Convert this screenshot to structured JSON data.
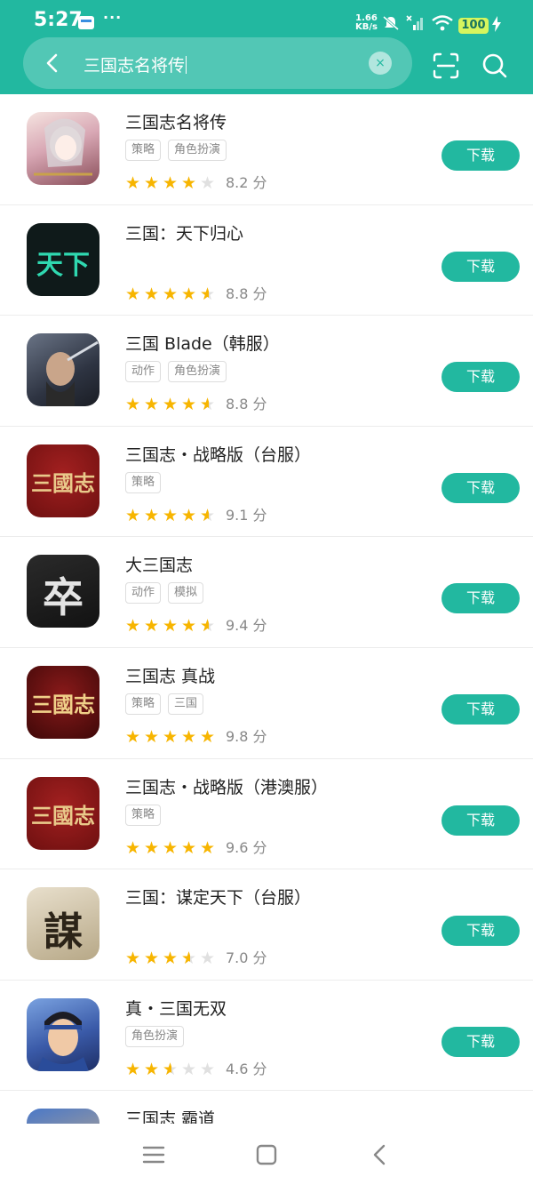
{
  "status_bar": {
    "time": "5:27",
    "more": "···",
    "net_speed_value": "1.66",
    "net_speed_unit": "KB/s",
    "battery": "100"
  },
  "search": {
    "query": "三国志名将传",
    "clear_label": "×"
  },
  "download_label": "下载",
  "score_unit": "分",
  "apps": [
    {
      "title": "三国志名将传",
      "tags": [
        "策略",
        "角色扮演"
      ],
      "rating": 4,
      "score": "8.2",
      "icon_glyph": "",
      "icon_colors": [
        "#f2d9d6",
        "#8a4f5a"
      ]
    },
    {
      "title": "三国：天下归心",
      "tags": [],
      "rating": 4.5,
      "score": "8.8",
      "icon_glyph": "天下",
      "icon_colors": [
        "#0f1a1a",
        "#2fd8b0"
      ]
    },
    {
      "title": "三国 Blade（韩服）",
      "tags": [
        "动作",
        "角色扮演"
      ],
      "rating": 4.5,
      "score": "8.8",
      "icon_glyph": "",
      "icon_colors": [
        "#2e3442",
        "#6a7486"
      ]
    },
    {
      "title": "三国志・战略版（台服）",
      "tags": [
        "策略"
      ],
      "rating": 4.5,
      "score": "9.1",
      "icon_glyph": "三國志",
      "icon_colors": [
        "#7a1414",
        "#e9c98a"
      ]
    },
    {
      "title": "大三国志",
      "tags": [
        "动作",
        "模拟"
      ],
      "rating": 4.5,
      "score": "9.4",
      "icon_glyph": "卒",
      "icon_colors": [
        "#1c1c1c",
        "#e4e4e4"
      ]
    },
    {
      "title": "三国志 真战",
      "tags": [
        "策略",
        "三国"
      ],
      "rating": 5,
      "score": "9.8",
      "icon_glyph": "三國志",
      "icon_colors": [
        "#5a0d0d",
        "#f0d089"
      ]
    },
    {
      "title": "三国志・战略版（港澳服）",
      "tags": [
        "策略"
      ],
      "rating": 5,
      "score": "9.6",
      "icon_glyph": "三國志",
      "icon_colors": [
        "#7a1414",
        "#e9c98a"
      ]
    },
    {
      "title": "三国：谋定天下（台服）",
      "tags": [],
      "rating": 3.5,
      "score": "7.0",
      "icon_glyph": "謀",
      "icon_colors": [
        "#cfc3a8",
        "#2c2418"
      ]
    },
    {
      "title": "真・三国无双",
      "tags": [
        "角色扮演"
      ],
      "rating": 2.5,
      "score": "4.6",
      "icon_glyph": "",
      "icon_colors": [
        "#3a5aa8",
        "#f0c9a6"
      ]
    },
    {
      "title": "三国志 霸道",
      "tags": [],
      "rating": 0,
      "score": "",
      "icon_glyph": "",
      "icon_colors": [
        "#4a78c8",
        "#d9b27a"
      ]
    }
  ],
  "colors": {
    "accent": "#22b8a0",
    "star": "#f7b500",
    "star_empty": "#e0e0e0"
  }
}
